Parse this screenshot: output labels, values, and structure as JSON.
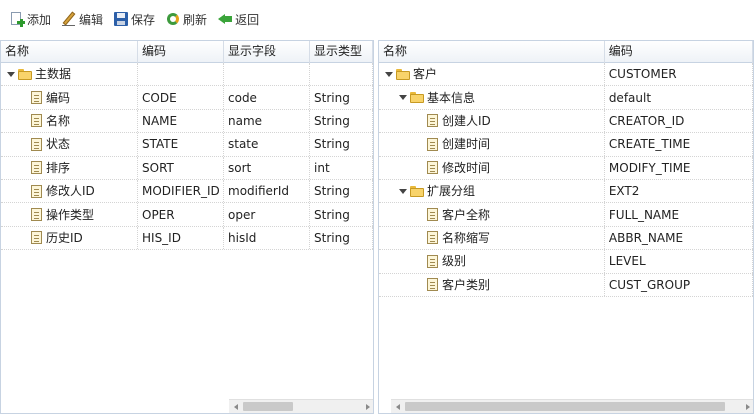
{
  "toolbar": {
    "add": "添加",
    "edit": "编辑",
    "save": "保存",
    "refresh": "刷新",
    "back": "返回"
  },
  "left_grid": {
    "columns": [
      "名称",
      "编码",
      "显示字段",
      "显示类型"
    ],
    "root": {
      "name": "主数据",
      "code": "",
      "field": "",
      "type": ""
    },
    "rows": [
      {
        "name": "编码",
        "code": "CODE",
        "field": "code",
        "type": "String"
      },
      {
        "name": "名称",
        "code": "NAME",
        "field": "name",
        "type": "String"
      },
      {
        "name": "状态",
        "code": "STATE",
        "field": "state",
        "type": "String"
      },
      {
        "name": "排序",
        "code": "SORT",
        "field": "sort",
        "type": "int"
      },
      {
        "name": "修改人ID",
        "code": "MODIFIER_ID",
        "field": "modifierId",
        "type": "String"
      },
      {
        "name": "操作类型",
        "code": "OPER",
        "field": "oper",
        "type": "String"
      },
      {
        "name": "历史ID",
        "code": "HIS_ID",
        "field": "hisId",
        "type": "String"
      }
    ]
  },
  "right_grid": {
    "columns": [
      "名称",
      "编码"
    ],
    "root": {
      "name": "客户",
      "code": "CUSTOMER"
    },
    "group1": {
      "name": "基本信息",
      "code": "default"
    },
    "group1_rows": [
      {
        "name": "创建人ID",
        "code": "CREATOR_ID"
      },
      {
        "name": "创建时间",
        "code": "CREATE_TIME"
      },
      {
        "name": "修改时间",
        "code": "MODIFY_TIME"
      }
    ],
    "group2": {
      "name": "扩展分组",
      "code": "EXT2"
    },
    "group2_rows": [
      {
        "name": "客户全称",
        "code": "FULL_NAME"
      },
      {
        "name": "名称缩写",
        "code": "ABBR_NAME"
      },
      {
        "name": "级别",
        "code": "LEVEL"
      },
      {
        "name": "客户类别",
        "code": "CUST_GROUP"
      }
    ]
  }
}
